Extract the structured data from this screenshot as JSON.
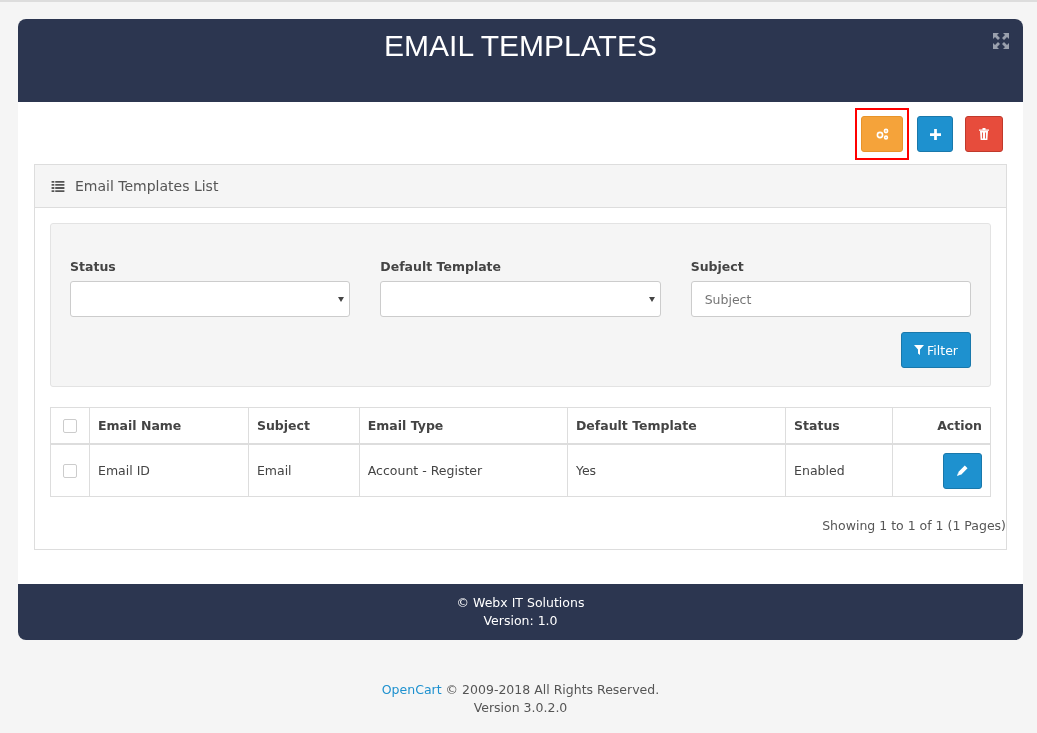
{
  "header": {
    "title": "EMAIL TEMPLATES"
  },
  "toolbar": [
    {
      "kind": "settings",
      "highlighted": true
    },
    {
      "kind": "add",
      "highlighted": false
    },
    {
      "kind": "delete",
      "highlighted": false
    }
  ],
  "panel": {
    "title": "Email Templates List"
  },
  "filters": [
    {
      "label": "Status",
      "kind": "select"
    },
    {
      "label": "Default Template",
      "kind": "select"
    },
    {
      "label": "Subject",
      "kind": "text",
      "placeholder": "Subject"
    }
  ],
  "filter_button": "Filter",
  "table": {
    "select_all_checked": false,
    "columns": [
      "Email Name",
      "Subject",
      "Email Type",
      "Default Template",
      "Status",
      "Action"
    ],
    "rows": [
      {
        "checked": false,
        "cells": [
          "Email ID",
          "Email",
          "Account - Register",
          "Yes",
          "Enabled"
        ]
      }
    ]
  },
  "pagination": "Showing 1 to 1 of 1 (1 Pages)",
  "footer": [
    "© Webx IT Solutions",
    "Version: 1.0"
  ],
  "page_footer": {
    "link": "OpenCart",
    "text": "© 2009-2018 All Rights Reserved.",
    "version": "Version 3.0.2.0"
  }
}
